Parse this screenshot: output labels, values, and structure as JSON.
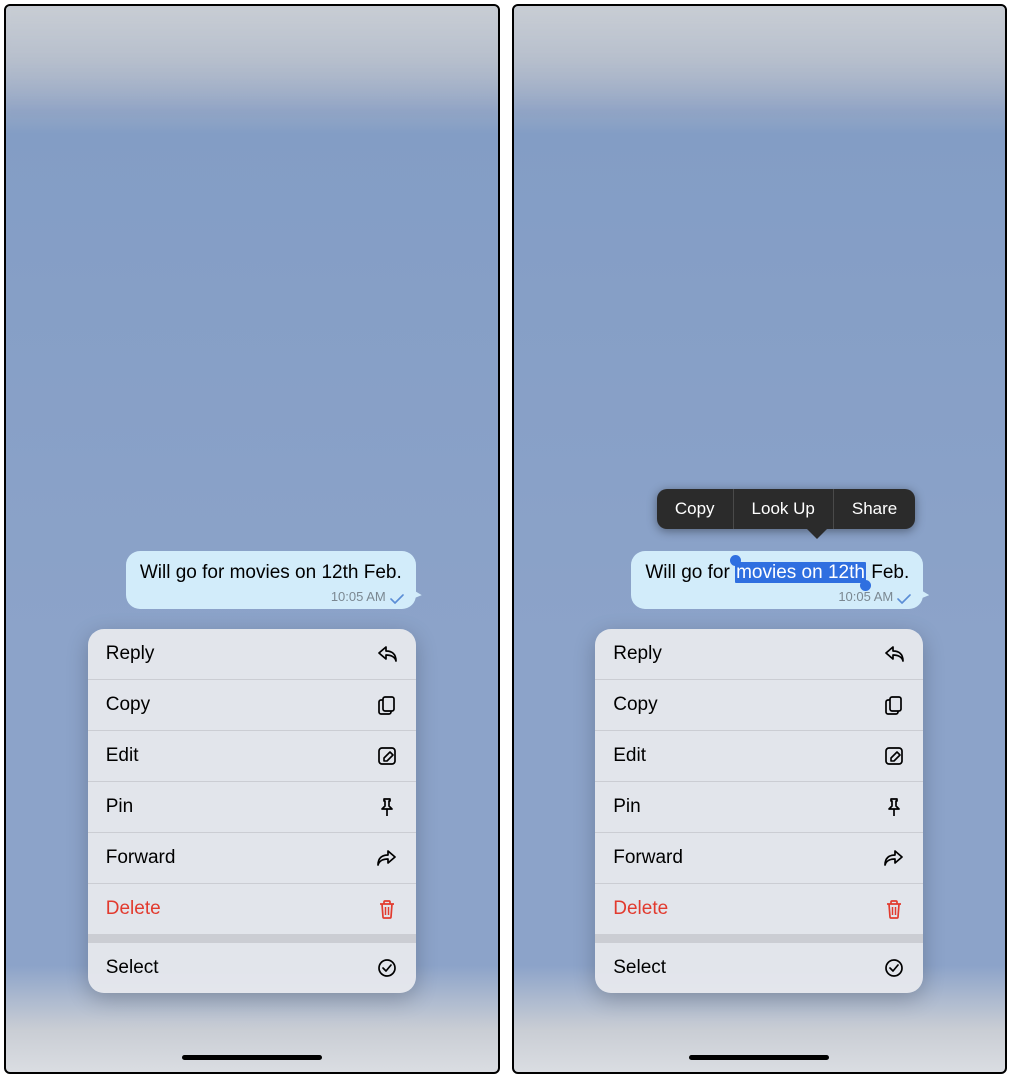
{
  "message": {
    "text_before": "Will go for ",
    "text_selected": "movies on 12th",
    "text_after": " Feb.",
    "full_text": "Will go for movies on 12th Feb.",
    "time": "10:05 AM"
  },
  "callout": {
    "items": [
      "Copy",
      "Look Up",
      "Share"
    ]
  },
  "context_menu": {
    "items": [
      {
        "label": "Reply",
        "icon": "reply-icon",
        "destructive": false
      },
      {
        "label": "Copy",
        "icon": "copy-icon",
        "destructive": false
      },
      {
        "label": "Edit",
        "icon": "edit-icon",
        "destructive": false
      },
      {
        "label": "Pin",
        "icon": "pin-icon",
        "destructive": false
      },
      {
        "label": "Forward",
        "icon": "forward-icon",
        "destructive": false
      },
      {
        "label": "Delete",
        "icon": "trash-icon",
        "destructive": true
      }
    ],
    "secondary": [
      {
        "label": "Select",
        "icon": "select-icon",
        "destructive": false
      }
    ]
  }
}
